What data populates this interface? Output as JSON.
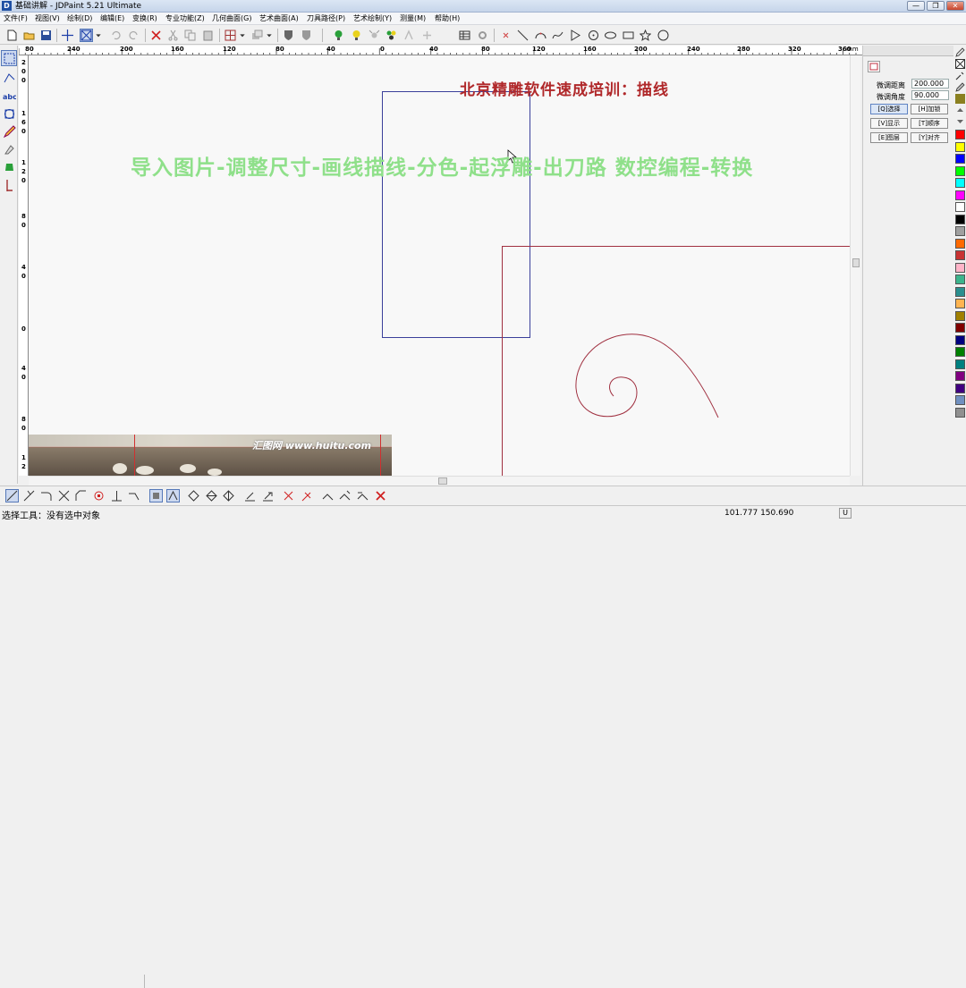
{
  "window": {
    "title": "基础讲解 - JDPaint 5.21 Ultimate",
    "minimize": "—",
    "restore": "❐",
    "close": "✕"
  },
  "menu": [
    "文件(F)",
    "视图(V)",
    "绘制(D)",
    "编辑(E)",
    "变换(R)",
    "专业功能(Z)",
    "几何曲面(G)",
    "艺术曲面(A)",
    "刀具路径(P)",
    "艺术绘制(Y)",
    "测量(M)",
    "帮助(H)"
  ],
  "ruler": {
    "unit": "mm",
    "h_labels": [
      "80",
      "240",
      "200",
      "160",
      "120",
      "80",
      "40",
      "0",
      "40",
      "80",
      "120",
      "160",
      "200",
      "240",
      "280",
      "320",
      "360"
    ],
    "v_labels": [
      "2",
      "0",
      "0",
      "1",
      "6",
      "0",
      "1",
      "2",
      "0",
      "8",
      "0",
      "4",
      "0",
      "0",
      "4",
      "0",
      "8",
      "0",
      "1",
      "2"
    ]
  },
  "canvas": {
    "title_banner": "北京精雕软件速成培训：描线",
    "workflow_text": "导入图片-调整尺寸-画线描线-分色-起浮雕-出刀路  数控编程-转换",
    "photo_watermark": "汇图网 www.huitu.com"
  },
  "panel": {
    "distance_label": "微调距离",
    "distance_value": "200.000",
    "angle_label": "微调角度",
    "angle_value": "90.000",
    "buttons": [
      "[Q]选择",
      "[H]加锁",
      "[V]显示",
      "[T]顺序",
      "[E]图层",
      "[Y]对齐"
    ]
  },
  "palette_colors": [
    "#ff0000",
    "#ffff00",
    "#0000ff",
    "#00ff00",
    "#00ffff",
    "#ff00ff",
    "#ffffff",
    "#000000",
    "#a0a0a0",
    "#ff6a00",
    "#c83232",
    "#ffb4c8",
    "#3cb48c",
    "#2a8f8f",
    "#ffb450",
    "#a08000",
    "#800000",
    "#000080",
    "#008000",
    "#008080",
    "#800080",
    "#400080",
    "#7090c0",
    "#909090"
  ],
  "status": {
    "message": "选择工具：没有选中对象",
    "coords": "101.777  150.690",
    "unit_button": "U"
  }
}
